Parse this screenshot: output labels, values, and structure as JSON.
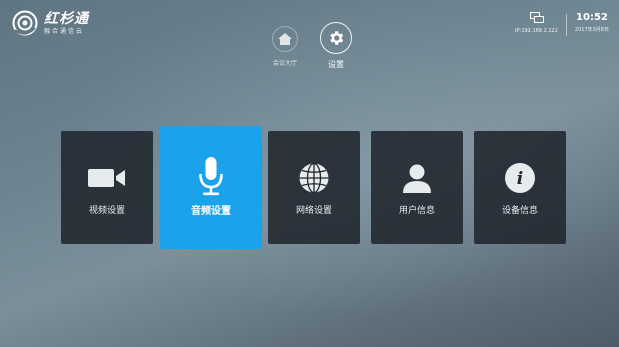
{
  "brand": {
    "title": "红杉通",
    "subtitle": "融合通信云"
  },
  "status": {
    "ip": "IP:192.168.2.122",
    "time": "10:52",
    "date": "2017年3月8日"
  },
  "topnav": [
    {
      "label": "会议大厅",
      "icon": "home-icon",
      "active": false
    },
    {
      "label": "设置",
      "icon": "gear-icon",
      "active": true
    }
  ],
  "cards": [
    {
      "label": "视频设置",
      "icon": "video-camera-icon",
      "active": false
    },
    {
      "label": "音频设置",
      "icon": "microphone-icon",
      "active": true
    },
    {
      "label": "网络设置",
      "icon": "globe-icon",
      "active": false
    },
    {
      "label": "用户信息",
      "icon": "user-icon",
      "active": false
    },
    {
      "label": "设备信息",
      "icon": "info-icon",
      "active": false
    }
  ],
  "colors": {
    "accent": "#1aa3ea",
    "card_bg": "#20262d"
  }
}
